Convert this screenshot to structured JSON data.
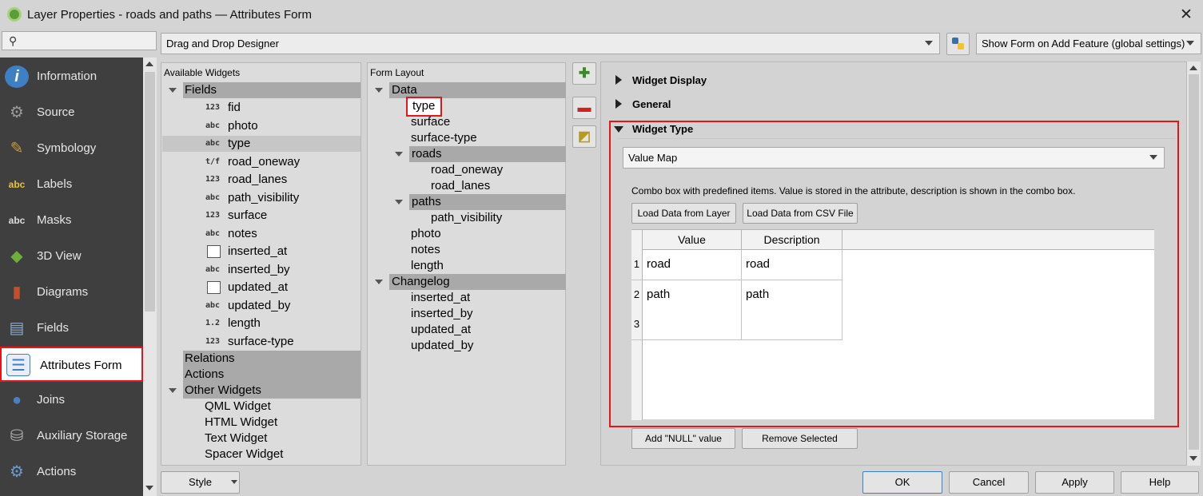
{
  "window": {
    "title": "Layer Properties - roads and paths — Attributes Form",
    "close_glyph": "✕"
  },
  "search": {
    "icon": "search-icon",
    "glyph": "⚲"
  },
  "sidebar": {
    "items": [
      {
        "label": "Information",
        "icon": "info-icon",
        "glyph": "i",
        "color": "#3f7fc4"
      },
      {
        "label": "Source",
        "icon": "wrench-icon",
        "glyph": "⚙",
        "color": "#999999"
      },
      {
        "label": "Symbology",
        "icon": "brush-icon",
        "glyph": "✎",
        "color": "#c99a3b"
      },
      {
        "label": "Labels",
        "icon": "labels-icon",
        "glyph": "abc",
        "color": "#e8c33a"
      },
      {
        "label": "Masks",
        "icon": "masks-icon",
        "glyph": "abc",
        "color": "#dddddd"
      },
      {
        "label": "3D View",
        "icon": "cube-icon",
        "glyph": "◆",
        "color": "#6fae3a"
      },
      {
        "label": "Diagrams",
        "icon": "diagrams-icon",
        "glyph": "▮",
        "color": "#c0502e"
      },
      {
        "label": "Fields",
        "icon": "fields-icon",
        "glyph": "▤",
        "color": "#8aa9c9"
      },
      {
        "label": "Attributes Form",
        "icon": "form-icon",
        "glyph": "☰",
        "color": "#3f7fc4"
      },
      {
        "label": "Joins",
        "icon": "joins-icon",
        "glyph": "●",
        "color": "#4a80c0"
      },
      {
        "label": "Auxiliary Storage",
        "icon": "database-icon",
        "glyph": "⛁",
        "color": "#b0b0b0"
      },
      {
        "label": "Actions",
        "icon": "actions-icon",
        "glyph": "⚙",
        "color": "#6c9bd0"
      }
    ]
  },
  "designer": {
    "mode": "Drag and Drop Designer",
    "python_icon": "python-icon",
    "show_form": "Show Form on Add Feature (global settings)"
  },
  "available_widgets": {
    "header": "Available Widgets",
    "fields_label": "Fields",
    "fields": [
      {
        "type": "123",
        "name": "fid"
      },
      {
        "type": "abc",
        "name": "photo"
      },
      {
        "type": "abc",
        "name": "type"
      },
      {
        "type": "t/f",
        "name": "road_oneway"
      },
      {
        "type": "123",
        "name": "road_lanes"
      },
      {
        "type": "abc",
        "name": "path_visibility"
      },
      {
        "type": "123",
        "name": "surface"
      },
      {
        "type": "abc",
        "name": "notes"
      },
      {
        "type": "dt",
        "name": "inserted_at"
      },
      {
        "type": "abc",
        "name": "inserted_by"
      },
      {
        "type": "dt",
        "name": "updated_at"
      },
      {
        "type": "abc",
        "name": "updated_by"
      },
      {
        "type": "1.2",
        "name": "length"
      },
      {
        "type": "123",
        "name": "surface-type"
      }
    ],
    "relations_label": "Relations",
    "actions_label": "Actions",
    "other_label": "Other Widgets",
    "other": [
      "QML Widget",
      "HTML Widget",
      "Text Widget",
      "Spacer Widget"
    ]
  },
  "form_layout": {
    "header": "Form Layout",
    "data_label": "Data",
    "data_items": [
      "type",
      "surface",
      "surface-type"
    ],
    "roads_label": "roads",
    "roads_items": [
      "road_oneway",
      "road_lanes"
    ],
    "paths_label": "paths",
    "paths_items": [
      "path_visibility"
    ],
    "after_paths": [
      "photo",
      "notes",
      "length"
    ],
    "changelog_label": "Changelog",
    "changelog_items": [
      "inserted_at",
      "inserted_by",
      "updated_at",
      "updated_by"
    ]
  },
  "toolbar": {
    "add_icon": "add-icon",
    "remove_icon": "remove-icon",
    "edit_icon": "edit-icon"
  },
  "config": {
    "widget_display": "Widget Display",
    "general": "General",
    "widget_type": "Widget Type",
    "widget_select": "Value Map",
    "description": "Combo box with predefined items. Value is stored in the attribute, description is shown in the combo box.",
    "load_layer": "Load Data from Layer",
    "load_csv": "Load Data from CSV File",
    "col_value": "Value",
    "col_description": "Description",
    "rows": [
      {
        "num": "1",
        "value": "road",
        "description": "road"
      },
      {
        "num": "2",
        "value": "path",
        "description": "path"
      },
      {
        "num": "3",
        "value": "",
        "description": ""
      }
    ],
    "add_null": "Add \"NULL\" value",
    "remove_selected": "Remove Selected"
  },
  "footer": {
    "style": "Style",
    "ok": "OK",
    "cancel": "Cancel",
    "apply": "Apply",
    "help": "Help"
  },
  "colors": {
    "highlight": "#e8141a",
    "sidebar_bg": "#3f3f3f",
    "group_bg": "#a9a9a9"
  }
}
